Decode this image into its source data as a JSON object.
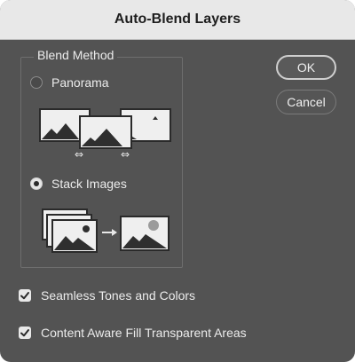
{
  "dialog": {
    "title": "Auto-Blend Layers",
    "blend_method": {
      "legend": "Blend Method",
      "options": [
        {
          "label": "Panorama",
          "selected": false,
          "illustration": "panorama-illustration"
        },
        {
          "label": "Stack Images",
          "selected": true,
          "illustration": "stack-images-illustration"
        }
      ]
    },
    "buttons": {
      "ok": "OK",
      "cancel": "Cancel"
    },
    "checkboxes": [
      {
        "label": "Seamless Tones and Colors",
        "checked": true
      },
      {
        "label": "Content Aware Fill Transparent Areas",
        "checked": true
      }
    ]
  }
}
